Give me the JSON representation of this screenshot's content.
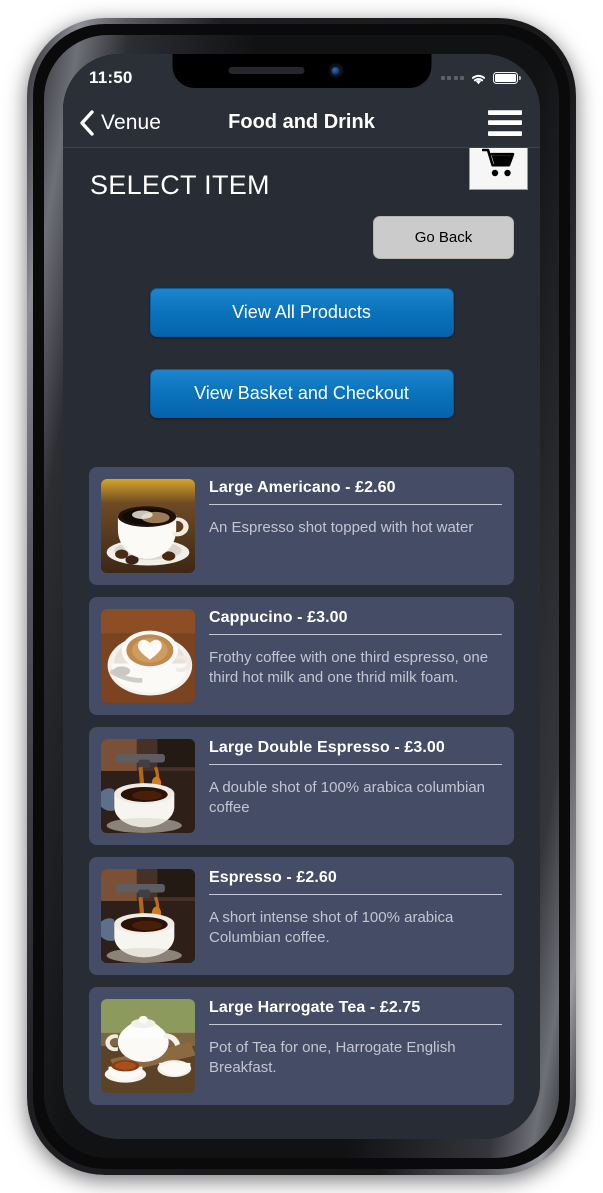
{
  "status_bar": {
    "time": "11:50",
    "signal_icon": "signal-dots-icon",
    "wifi_icon": "wifi-icon",
    "battery_icon": "battery-full-icon"
  },
  "nav_bar": {
    "back_icon": "chevron-left-icon",
    "back_label": "Venue",
    "title": "Food and Drink",
    "menu_icon": "hamburger-menu-icon"
  },
  "content": {
    "page_title": "SELECT ITEM",
    "cart_icon": "shopping-cart-icon",
    "go_back_label": "Go Back",
    "view_all_label": "View All Products",
    "view_basket_label": "View Basket and Checkout"
  },
  "colors": {
    "page_background": "#282c34",
    "bar_background": "#2b2f38",
    "card_background": "#454c66",
    "primary_button": "#0a72bb",
    "secondary_button": "#cbcbcb",
    "cart_button": "#f6f6f6",
    "title_text": "#ffffff",
    "description_text": "#c3c6d2"
  },
  "products": [
    {
      "title": "Large Americano - £2.60",
      "description": "An Espresso shot topped with hot water",
      "image": "black-coffee-cup-with-beans-photo"
    },
    {
      "title": "Cappucino - £3.00",
      "description": "Frothy coffee with one third espresso, one third hot milk and one thrid milk foam.",
      "image": "cappuccino-latte-art-heart-photo"
    },
    {
      "title": "Large Double Espresso - £3.00",
      "description": "A double shot of 100% arabica columbian coffee",
      "image": "espresso-pouring-into-cup-photo"
    },
    {
      "title": "Espresso - £2.60",
      "description": "A short intense shot of 100% arabica Columbian coffee.",
      "image": "espresso-pouring-into-cup-photo"
    },
    {
      "title": "Large Harrogate Tea - £2.75",
      "description": "Pot of Tea for one, Harrogate English Breakfast.",
      "image": "teapot-and-teacup-photo"
    }
  ]
}
